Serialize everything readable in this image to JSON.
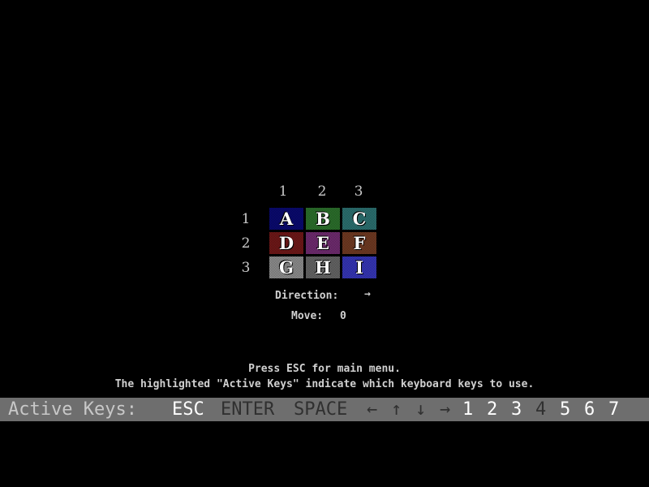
{
  "grid": {
    "col_labels": [
      "1",
      "2",
      "3"
    ],
    "row_labels": [
      "1",
      "2",
      "3"
    ],
    "tiles": [
      {
        "letter": "A",
        "color": "#0a0a7a"
      },
      {
        "letter": "B",
        "color": "#2f7a2f"
      },
      {
        "letter": "C",
        "color": "#2f7a7a"
      },
      {
        "letter": "D",
        "color": "#7a1a1a"
      },
      {
        "letter": "E",
        "color": "#7a2f7a"
      },
      {
        "letter": "F",
        "color": "#7a3f25"
      },
      {
        "letter": "G",
        "color": "#9a9a9a"
      },
      {
        "letter": "H",
        "color": "#6e6e6e"
      },
      {
        "letter": "I",
        "color": "#3a3ac8"
      }
    ]
  },
  "status": {
    "direction_label": "Direction:",
    "direction_icon": "right-arrow",
    "direction_value": "→",
    "move_label": "Move:",
    "move_value": "0"
  },
  "instructions": {
    "line1": "Press ESC for main menu.",
    "line2": "The highlighted \"Active Keys\" indicate which keyboard keys to use."
  },
  "active_keys_bar": {
    "label": "Active Keys:",
    "keys": [
      {
        "label": "ESC",
        "active": true
      },
      {
        "label": "ENTER",
        "active": false
      },
      {
        "label": "SPACE",
        "active": false
      },
      {
        "label": "←",
        "active": false
      },
      {
        "label": "↑",
        "active": false
      },
      {
        "label": "↓",
        "active": false
      },
      {
        "label": "→",
        "active": false
      },
      {
        "label": "1",
        "active": true
      },
      {
        "label": "2",
        "active": true
      },
      {
        "label": "3",
        "active": true
      },
      {
        "label": "4",
        "active": false
      },
      {
        "label": "5",
        "active": true
      },
      {
        "label": "6",
        "active": true
      },
      {
        "label": "7",
        "active": true
      }
    ],
    "colors": {
      "bar": "#6e6e6e",
      "active": "#ffffff",
      "inactive": "#303030"
    }
  }
}
